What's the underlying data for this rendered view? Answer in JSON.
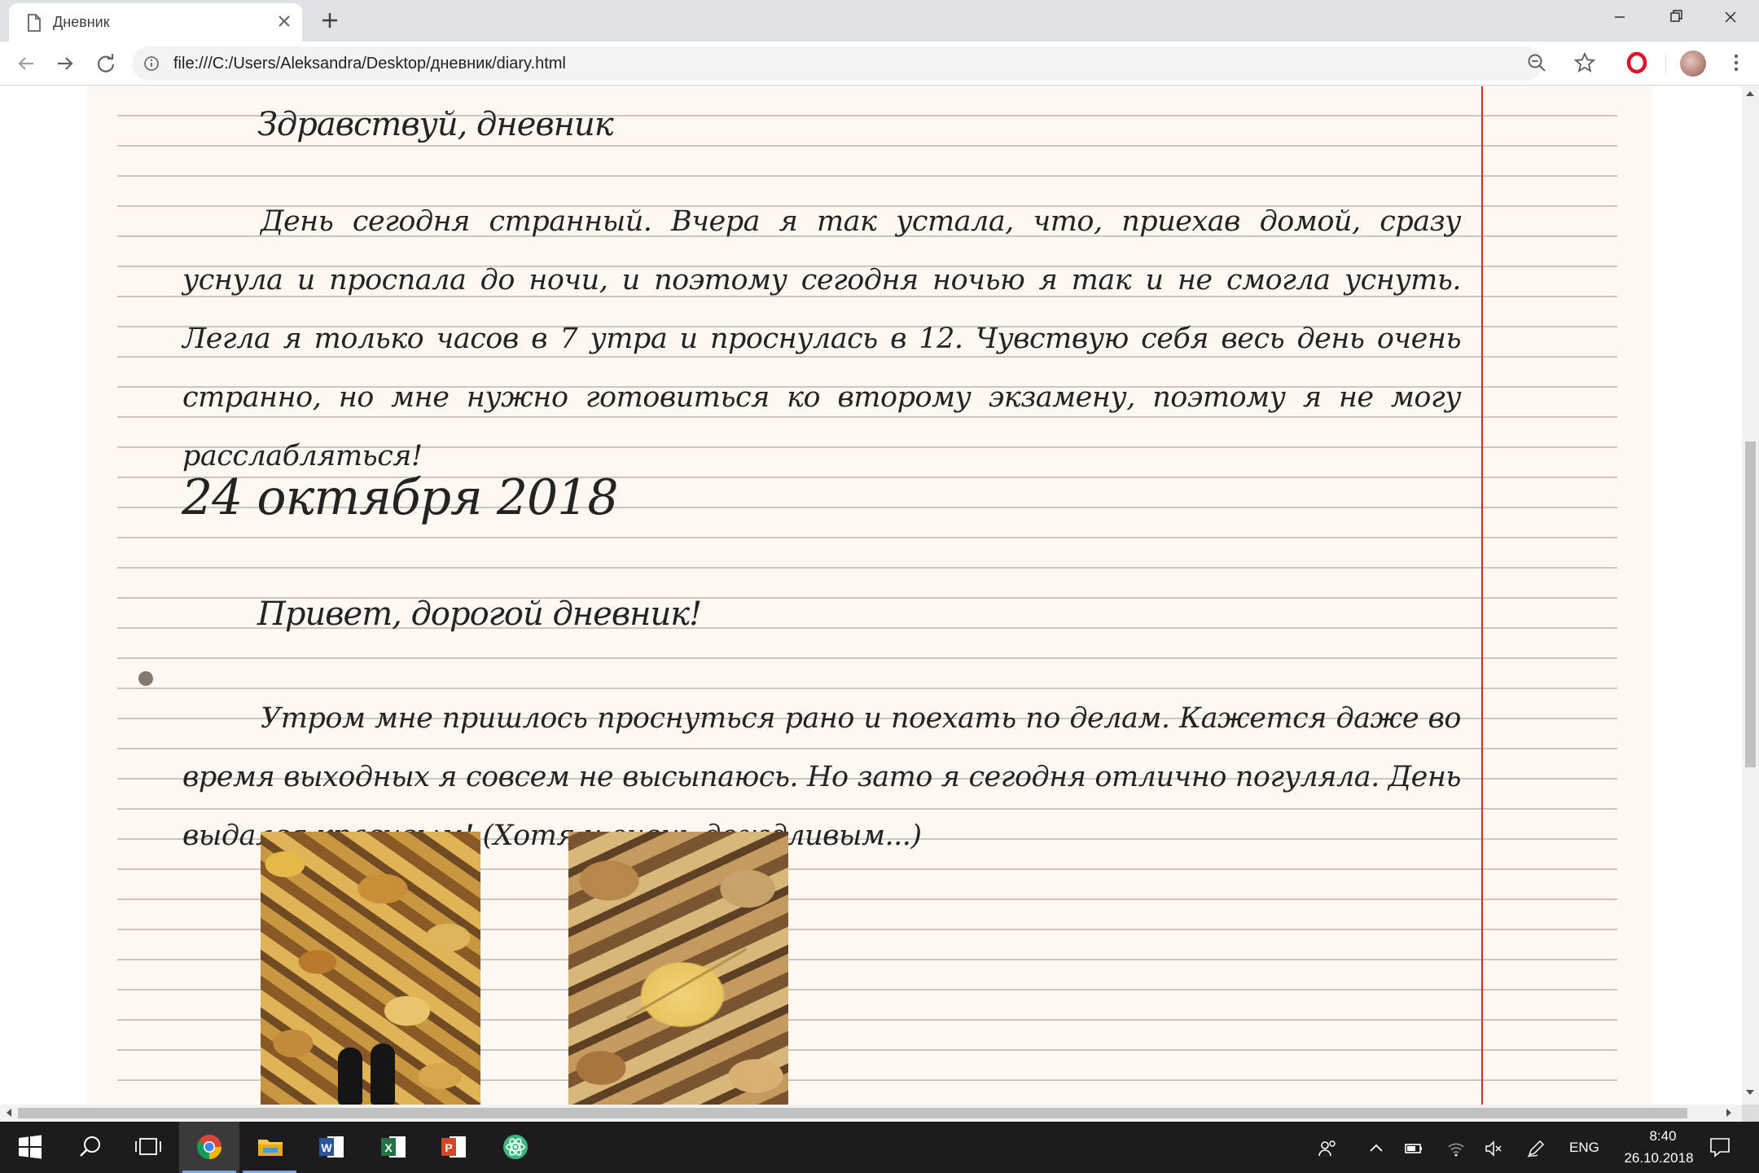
{
  "browser": {
    "tab": {
      "title": "Дневник",
      "favicon": "page-icon",
      "close": "close-icon"
    },
    "new_tab": "plus-icon",
    "window_controls": [
      "minimize-icon",
      "restore-icon",
      "close-icon"
    ],
    "nav": [
      "back-arrow-icon",
      "forward-arrow-icon",
      "reload-icon"
    ],
    "address": {
      "url": "file:///C:/Users/Aleksandra/Desktop/дневник/diary.html",
      "icon": "info-icon"
    },
    "toolbar_icons": [
      "zoom-icon",
      "star-icon",
      "opera-icon",
      "avatar",
      "menu-icon"
    ]
  },
  "page": {
    "colors": {
      "paper": "#fff7f1",
      "rule": "#c9c6c3",
      "margin": "#d92a2a",
      "ink": "#232323"
    },
    "entry1": {
      "greeting": "Здравствуй, дневник",
      "text": "День сегодня странный. Вчера я так устала, что, приехав домой, сразу уснула и проспала до ночи, и поэтому сегодня ночью я так и не смогла уснуть. Легла я только часов в 7 утра и проснулась в 12. Чувствую себя весь день очень странно, но мне нужно готовиться ко второму экзамену, поэтому я не могу расслабляться!"
    },
    "entry2": {
      "date": "24 октября 2018",
      "greeting": "Привет, дорогой дневник!",
      "text": "Утром мне пришлось проснуться рано и поехать по делам. Кажется даже во время выходных я совсем не высыпаюсь. Но зато я сегодня отлично погуляла. День выдался красивым! (Хотя и очень дождливым...)",
      "photos": [
        "autumn-leaves-photo-feet",
        "autumn-leaves-photo-maple"
      ]
    }
  },
  "taskbar": {
    "apps": [
      "windows-start-icon",
      "search-icon",
      "task-view-icon",
      "chrome-icon",
      "file-explorer-icon",
      "word-icon",
      "excel-icon",
      "powerpoint-icon",
      "atom-icon"
    ],
    "tray": [
      "people-icon",
      "chevron-up-icon",
      "battery-icon",
      "wifi-icon",
      "volume-muted-icon",
      "pen-icon"
    ],
    "language": "ENG",
    "time": "8:40",
    "date": "26.10.2018",
    "notifications": "notification-icon"
  }
}
